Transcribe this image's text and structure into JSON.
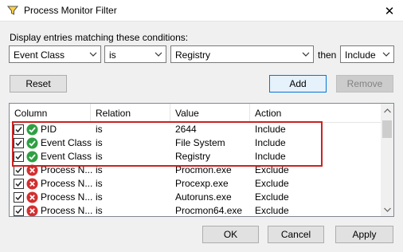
{
  "window": {
    "title": "Process Monitor Filter",
    "app_icon": "filter-funnel-icon",
    "close_glyph": "✕"
  },
  "condition_row": {
    "label": "Display entries matching these conditions:",
    "column_value": "Event Class",
    "relation_value": "is",
    "value_text": "Registry",
    "then_label": "then",
    "action_value": "Include"
  },
  "buttons": {
    "reset": "Reset",
    "add": "Add",
    "remove": "Remove",
    "ok": "OK",
    "cancel": "Cancel",
    "apply": "Apply"
  },
  "table": {
    "headers": [
      "Column",
      "Relation",
      "Value",
      "Action"
    ],
    "rows": [
      {
        "checked": true,
        "status_icon": "green-check-icon",
        "column": "PID",
        "relation": "is",
        "value": "2644",
        "action": "Include"
      },
      {
        "checked": true,
        "status_icon": "green-check-icon",
        "column": "Event Class",
        "relation": "is",
        "value": "File System",
        "action": "Include"
      },
      {
        "checked": true,
        "status_icon": "green-check-icon",
        "column": "Event Class",
        "relation": "is",
        "value": "Registry",
        "action": "Include"
      },
      {
        "checked": true,
        "status_icon": "red-x-icon",
        "column": "Process N...",
        "relation": "is",
        "value": "Procmon.exe",
        "action": "Exclude"
      },
      {
        "checked": true,
        "status_icon": "red-x-icon",
        "column": "Process N...",
        "relation": "is",
        "value": "Procexp.exe",
        "action": "Exclude"
      },
      {
        "checked": true,
        "status_icon": "red-x-icon",
        "column": "Process N...",
        "relation": "is",
        "value": "Autoruns.exe",
        "action": "Exclude"
      },
      {
        "checked": true,
        "status_icon": "red-x-icon",
        "column": "Process N...",
        "relation": "is",
        "value": "Procmon64.exe",
        "action": "Exclude"
      }
    ]
  },
  "colors": {
    "include": "#2ea043",
    "exclude": "#d32f2f",
    "highlight": "#cc2222",
    "accent": "#0078d7"
  }
}
